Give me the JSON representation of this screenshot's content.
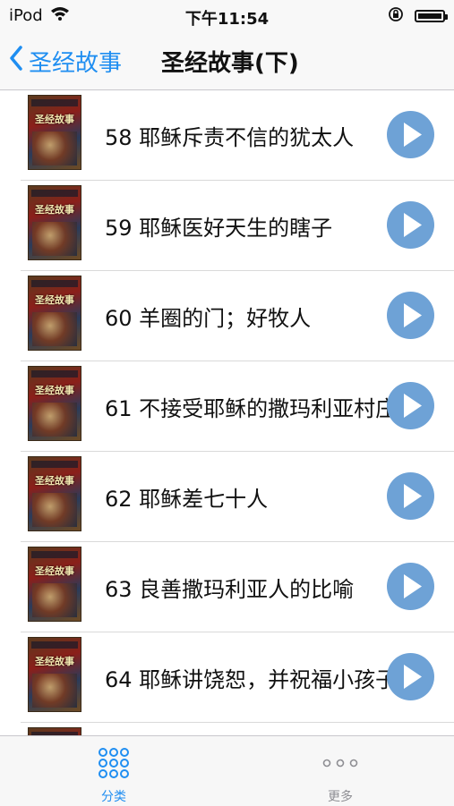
{
  "status_bar": {
    "carrier": "iPod",
    "time": "下午11:54"
  },
  "nav": {
    "back_label": "圣经故事",
    "title": "圣经故事(下)"
  },
  "list": {
    "cover_text": "圣经故事",
    "items": [
      {
        "title": "58 耶稣斥责不信的犹太人"
      },
      {
        "title": "59 耶稣医好天生的瞎子"
      },
      {
        "title": "60 羊圈的门；好牧人"
      },
      {
        "title": "61 不接受耶稣的撒玛利亚村庄"
      },
      {
        "title": "62 耶稣差七十人"
      },
      {
        "title": "63 良善撒玛利亚人的比喻"
      },
      {
        "title": "64 耶稣讲饶恕，并祝福小孩子"
      }
    ]
  },
  "tabbar": {
    "tabs": [
      {
        "label": "分类",
        "icon": "grid-icon",
        "active": true
      },
      {
        "label": "更多",
        "icon": "more-icon",
        "active": false
      }
    ]
  },
  "colors": {
    "accent": "#1f8ef1",
    "play_button": "#6ea2d6",
    "inactive": "#8e8e93"
  }
}
